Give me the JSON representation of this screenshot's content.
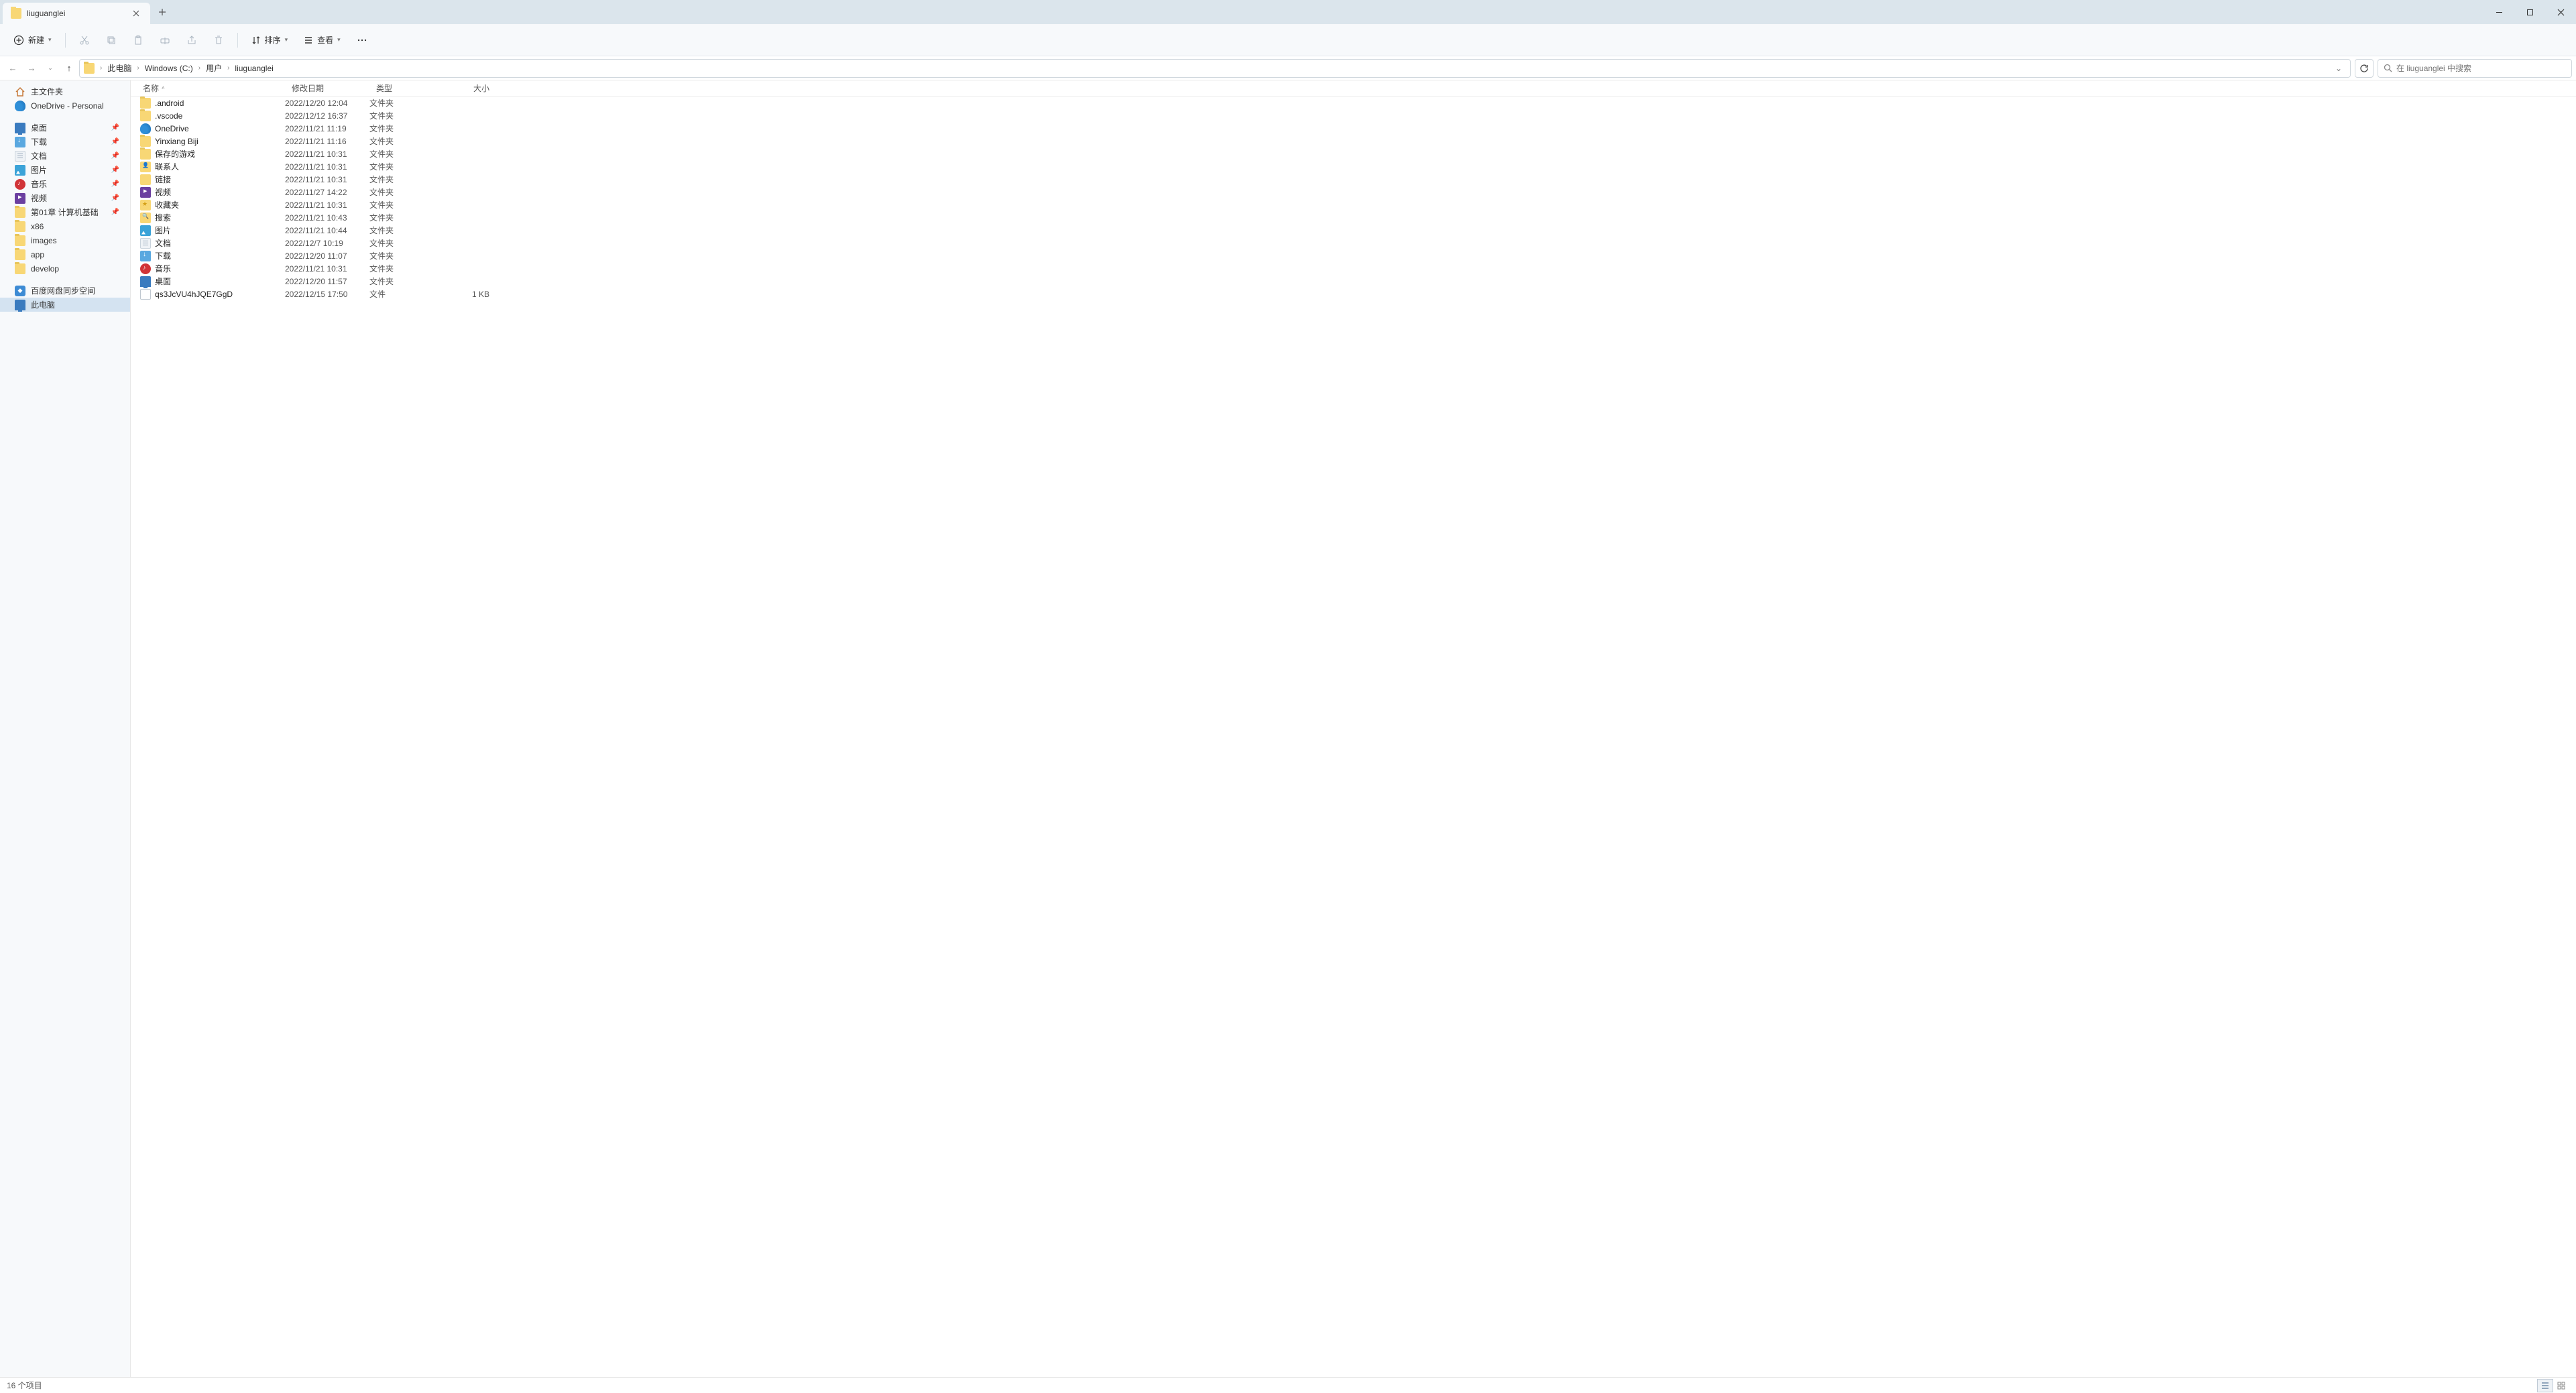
{
  "tab": {
    "title": "liuguanglei"
  },
  "toolbar": {
    "new_label": "新建",
    "sort_label": "排序",
    "view_label": "查看"
  },
  "breadcrumb": [
    "此电脑",
    "Windows (C:)",
    "用户",
    "liuguanglei"
  ],
  "search": {
    "placeholder": "在 liuguanglei 中搜索"
  },
  "sidebar": {
    "home": "主文件夹",
    "onedrive": "OneDrive - Personal",
    "quick": [
      {
        "icon": "desktop",
        "label": "桌面",
        "pinned": true
      },
      {
        "icon": "download",
        "label": "下载",
        "pinned": true
      },
      {
        "icon": "doc",
        "label": "文档",
        "pinned": true
      },
      {
        "icon": "picture",
        "label": "图片",
        "pinned": true
      },
      {
        "icon": "music",
        "label": "音乐",
        "pinned": true
      },
      {
        "icon": "video",
        "label": "视频",
        "pinned": true
      },
      {
        "icon": "folder",
        "label": "第01章 计算机基础",
        "pinned": true
      },
      {
        "icon": "folder",
        "label": "x86",
        "pinned": false
      },
      {
        "icon": "folder",
        "label": "images",
        "pinned": false
      },
      {
        "icon": "folder",
        "label": "app",
        "pinned": false
      },
      {
        "icon": "folder",
        "label": "develop",
        "pinned": false
      }
    ],
    "baidu": "百度网盘同步空间",
    "thispc": "此电脑"
  },
  "columns": {
    "name": "名称",
    "date": "修改日期",
    "type": "类型",
    "size": "大小"
  },
  "files": [
    {
      "icon": "folder",
      "name": ".android",
      "date": "2022/12/20 12:04",
      "type": "文件夹",
      "size": ""
    },
    {
      "icon": "folder",
      "name": ".vscode",
      "date": "2022/12/12 16:37",
      "type": "文件夹",
      "size": ""
    },
    {
      "icon": "onedrive",
      "name": "OneDrive",
      "date": "2022/11/21 11:19",
      "type": "文件夹",
      "size": ""
    },
    {
      "icon": "folder",
      "name": "Yinxiang Biji",
      "date": "2022/11/21 11:16",
      "type": "文件夹",
      "size": ""
    },
    {
      "icon": "folder",
      "name": "保存的游戏",
      "date": "2022/11/21 10:31",
      "type": "文件夹",
      "size": ""
    },
    {
      "icon": "contacts",
      "name": "联系人",
      "date": "2022/11/21 10:31",
      "type": "文件夹",
      "size": ""
    },
    {
      "icon": "link",
      "name": "链接",
      "date": "2022/11/21 10:31",
      "type": "文件夹",
      "size": ""
    },
    {
      "icon": "video",
      "name": "视频",
      "date": "2022/11/27 14:22",
      "type": "文件夹",
      "size": ""
    },
    {
      "icon": "star",
      "name": "收藏夹",
      "date": "2022/11/21 10:31",
      "type": "文件夹",
      "size": ""
    },
    {
      "icon": "search",
      "name": "搜索",
      "date": "2022/11/21 10:43",
      "type": "文件夹",
      "size": ""
    },
    {
      "icon": "picture",
      "name": "图片",
      "date": "2022/11/21 10:44",
      "type": "文件夹",
      "size": ""
    },
    {
      "icon": "doc",
      "name": "文档",
      "date": "2022/12/7 10:19",
      "type": "文件夹",
      "size": ""
    },
    {
      "icon": "download",
      "name": "下载",
      "date": "2022/12/20 11:07",
      "type": "文件夹",
      "size": ""
    },
    {
      "icon": "music",
      "name": "音乐",
      "date": "2022/11/21 10:31",
      "type": "文件夹",
      "size": ""
    },
    {
      "icon": "desktop",
      "name": "桌面",
      "date": "2022/12/20 11:57",
      "type": "文件夹",
      "size": ""
    },
    {
      "icon": "file",
      "name": "qs3JcVU4hJQE7GgD",
      "date": "2022/12/15 17:50",
      "type": "文件",
      "size": "1 KB"
    }
  ],
  "status": {
    "text": "16 个项目"
  }
}
